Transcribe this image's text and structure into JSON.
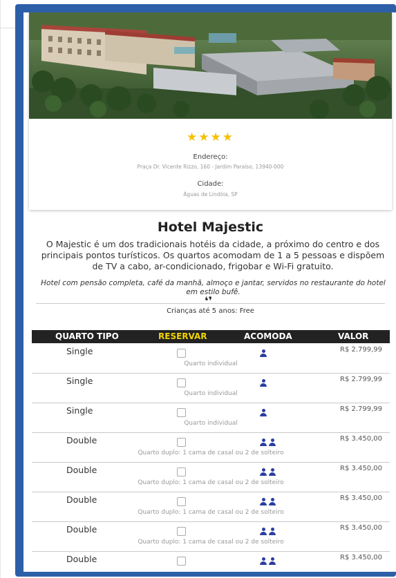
{
  "hotel": {
    "stars": "★★★★",
    "address_label": "Endereço:",
    "address": "Praça Dr. Vicente Rizzo, 160 - Jardim Paraíso, 13940-000",
    "city_label": "Cidade:",
    "city": "Águas de Lindóia, SP",
    "name": "Hotel Majestic",
    "description": "O Majestic é um dos tradicionais hotéis da cidade, a próximo do centro e dos principais pontos turísticos. Os quartos acomodam de 1 a 5 pessoas e dispõem de TV a cabo, ar-condicionado, frigobar e Wi-Fi gratuito.",
    "note": "Hotel com pensão completa, café da manhã, almoço e jantar, servidos no restaurante do hotel em estilo bufê.",
    "quote_mark": "❛❜",
    "children": "Crianças até 5 anos: Free"
  },
  "table": {
    "headers": {
      "tipo": "QUARTO TIPO",
      "reservar": "RESERVAR",
      "acomoda": "ACOMODA",
      "valor": "VALOR"
    },
    "rows": [
      {
        "type": "Single",
        "guests": 1,
        "price": "R$ 2.799,99",
        "desc": "Quarto individual"
      },
      {
        "type": "Single",
        "guests": 1,
        "price": "R$ 2.799,99",
        "desc": "Quarto individual"
      },
      {
        "type": "Single",
        "guests": 1,
        "price": "R$ 2.799,99",
        "desc": "Quarto individual"
      },
      {
        "type": "Double",
        "guests": 2,
        "price": "R$ 3.450,00",
        "desc": "Quarto duplo: 1 cama de casal ou 2 de solteiro"
      },
      {
        "type": "Double",
        "guests": 2,
        "price": "R$ 3.450,00",
        "desc": "Quarto duplo: 1 cama de casal ou 2 de solteiro"
      },
      {
        "type": "Double",
        "guests": 2,
        "price": "R$ 3.450,00",
        "desc": "Quarto duplo: 1 cama de casal ou 2 de solteiro"
      },
      {
        "type": "Double",
        "guests": 2,
        "price": "R$ 3.450,00",
        "desc": "Quarto duplo: 1 cama de casal ou 2 de solteiro"
      },
      {
        "type": "Double",
        "guests": 2,
        "price": "R$ 3.450,00",
        "desc": ""
      }
    ]
  },
  "colors": {
    "frame": "#2d5fa8",
    "header_bg": "#222222",
    "accent_yellow": "#f1d400",
    "person_icon": "#2b3ea0",
    "star": "#f2c200"
  }
}
